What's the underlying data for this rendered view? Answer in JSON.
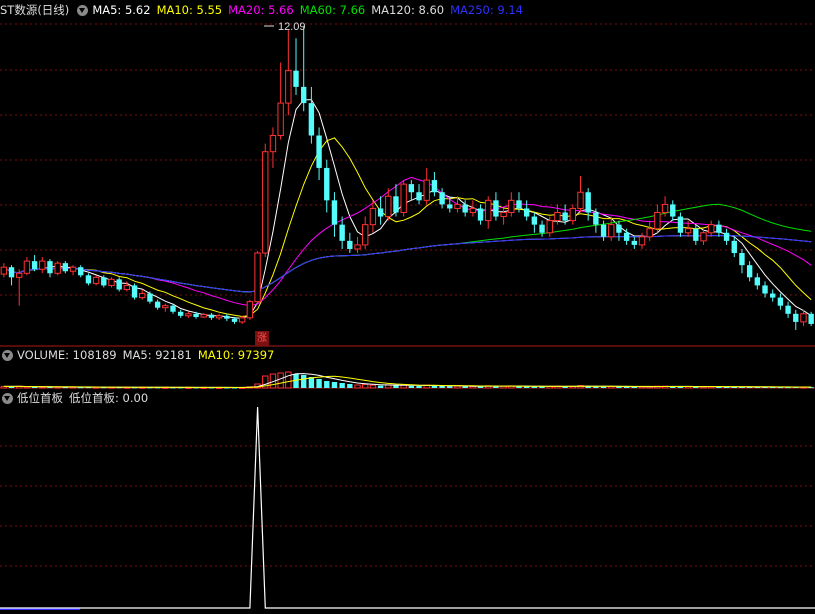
{
  "main": {
    "title": "ST数源(日线)",
    "ma": [
      {
        "label": "MA5: 5.62",
        "color": "#ffffff"
      },
      {
        "label": "MA10: 5.55",
        "color": "#ffff00"
      },
      {
        "label": "MA20: 5.66",
        "color": "#ff00ff"
      },
      {
        "label": "MA60: 7.66",
        "color": "#00e000"
      },
      {
        "label": "MA120: 8.60",
        "color": "#dddddd"
      },
      {
        "label": "MA250: 9.14",
        "color": "#3030ff"
      }
    ],
    "high_label": "12.09",
    "up_mark": "涨"
  },
  "volume": {
    "labels": [
      {
        "text": "VOLUME: 108189",
        "color": "#dddddd"
      },
      {
        "text": "MA5: 92181",
        "color": "#dddddd"
      },
      {
        "text": "MA10: 97397",
        "color": "#ffff00"
      }
    ]
  },
  "indicator": {
    "labels": [
      {
        "text": "低位首板",
        "color": "#dddddd"
      },
      {
        "text": "低位首板: 0.00",
        "color": "#dddddd"
      }
    ]
  },
  "colors": {
    "up": "#ff3232",
    "down": "#54fcfc",
    "grid": "#7a1010",
    "separator": "#b01818"
  },
  "chart_data": {
    "type": "candlestick",
    "price_range": [
      4.6,
      12.3
    ],
    "high_marker": 12.09,
    "candles": [
      [
        5.98,
        6.15,
        6.25,
        5.9
      ],
      [
        6.15,
        5.9,
        6.2,
        5.7
      ],
      [
        5.9,
        6.0,
        6.1,
        5.2
      ],
      [
        6.0,
        6.3,
        6.4,
        5.95
      ],
      [
        6.3,
        6.1,
        6.45,
        6.05
      ],
      [
        6.1,
        6.3,
        6.4,
        6.0
      ],
      [
        6.3,
        6.0,
        6.35,
        5.9
      ],
      [
        6.0,
        6.25,
        6.3,
        5.95
      ],
      [
        6.25,
        6.05,
        6.3,
        6.0
      ],
      [
        6.05,
        6.15,
        6.2,
        5.95
      ],
      [
        6.15,
        5.95,
        6.2,
        5.9
      ],
      [
        5.95,
        5.75,
        6.0,
        5.7
      ],
      [
        5.75,
        5.9,
        5.95,
        5.7
      ],
      [
        5.9,
        5.7,
        5.95,
        5.65
      ],
      [
        5.7,
        5.85,
        5.9,
        5.65
      ],
      [
        5.85,
        5.6,
        5.9,
        5.55
      ],
      [
        5.6,
        5.7,
        5.8,
        5.55
      ],
      [
        5.7,
        5.4,
        5.75,
        5.35
      ],
      [
        5.4,
        5.5,
        5.6,
        5.35
      ],
      [
        5.5,
        5.3,
        5.55,
        5.25
      ],
      [
        5.3,
        5.15,
        5.35,
        5.1
      ],
      [
        5.15,
        5.2,
        5.25,
        5.05
      ],
      [
        5.2,
        5.05,
        5.25,
        5.0
      ],
      [
        5.05,
        4.95,
        5.1,
        4.9
      ],
      [
        4.95,
        5.0,
        5.05,
        4.9
      ],
      [
        5.0,
        4.92,
        5.05,
        4.88
      ],
      [
        4.92,
        4.98,
        5.02,
        4.9
      ],
      [
        4.98,
        4.9,
        5.02,
        4.85
      ],
      [
        4.9,
        4.95,
        5.0,
        4.85
      ],
      [
        4.95,
        4.88,
        5.0,
        4.82
      ],
      [
        4.88,
        4.8,
        4.92,
        4.75
      ],
      [
        4.8,
        4.9,
        4.95,
        4.75
      ],
      [
        4.9,
        5.3,
        5.35,
        4.85
      ],
      [
        5.3,
        6.5,
        6.55,
        5.25
      ],
      [
        6.5,
        9.0,
        9.2,
        6.4
      ],
      [
        9.0,
        9.4,
        9.6,
        8.6
      ],
      [
        9.4,
        10.2,
        11.2,
        9.3
      ],
      [
        10.2,
        11.0,
        12.0,
        9.9
      ],
      [
        11.0,
        10.6,
        11.8,
        10.4
      ],
      [
        10.6,
        10.2,
        12.09,
        10.0
      ],
      [
        10.2,
        9.4,
        10.6,
        9.2
      ],
      [
        9.4,
        8.6,
        9.6,
        8.3
      ],
      [
        8.6,
        7.8,
        8.8,
        7.5
      ],
      [
        7.8,
        7.2,
        8.0,
        6.9
      ],
      [
        7.2,
        6.8,
        7.4,
        6.6
      ],
      [
        6.8,
        6.6,
        7.0,
        6.5
      ],
      [
        6.6,
        6.7,
        6.9,
        6.5
      ],
      [
        6.7,
        7.2,
        7.4,
        6.6
      ],
      [
        7.2,
        7.6,
        7.8,
        7.0
      ],
      [
        7.6,
        7.4,
        7.9,
        7.2
      ],
      [
        7.4,
        7.9,
        8.1,
        7.3
      ],
      [
        7.9,
        7.5,
        8.2,
        7.4
      ],
      [
        7.5,
        8.2,
        8.3,
        7.4
      ],
      [
        8.2,
        8.0,
        8.3,
        7.8
      ],
      [
        8.0,
        7.8,
        8.2,
        7.7
      ],
      [
        7.8,
        8.3,
        8.6,
        7.7
      ],
      [
        8.3,
        8.0,
        8.5,
        7.9
      ],
      [
        8.0,
        7.7,
        8.1,
        7.6
      ],
      [
        7.7,
        7.6,
        7.9,
        7.5
      ],
      [
        7.6,
        7.7,
        7.9,
        7.5
      ],
      [
        7.7,
        7.5,
        7.8,
        7.4
      ],
      [
        7.5,
        7.6,
        7.8,
        7.4
      ],
      [
        7.6,
        7.3,
        7.7,
        7.2
      ],
      [
        7.3,
        7.8,
        7.9,
        7.1
      ],
      [
        7.8,
        7.4,
        8.0,
        7.3
      ],
      [
        7.4,
        7.5,
        7.6,
        7.2
      ],
      [
        7.5,
        7.8,
        8.0,
        7.4
      ],
      [
        7.8,
        7.6,
        8.0,
        7.5
      ],
      [
        7.6,
        7.4,
        7.8,
        7.3
      ],
      [
        7.4,
        7.2,
        7.5,
        7.0
      ],
      [
        7.2,
        7.0,
        7.3,
        6.9
      ],
      [
        7.0,
        7.3,
        7.4,
        6.9
      ],
      [
        7.3,
        7.5,
        7.7,
        7.2
      ],
      [
        7.5,
        7.3,
        7.7,
        7.2
      ],
      [
        7.3,
        7.6,
        7.7,
        7.2
      ],
      [
        7.6,
        8.0,
        8.4,
        7.5
      ],
      [
        8.0,
        7.5,
        8.1,
        7.3
      ],
      [
        7.5,
        7.2,
        7.6,
        7.0
      ],
      [
        7.2,
        6.9,
        7.3,
        6.8
      ],
      [
        6.9,
        7.2,
        7.4,
        6.8
      ],
      [
        7.2,
        7.0,
        7.3,
        6.8
      ],
      [
        7.0,
        6.8,
        7.1,
        6.7
      ],
      [
        6.8,
        6.7,
        6.9,
        6.6
      ],
      [
        6.7,
        6.9,
        7.0,
        6.6
      ],
      [
        6.9,
        7.1,
        7.3,
        6.8
      ],
      [
        7.1,
        7.5,
        7.7,
        7.0
      ],
      [
        7.5,
        7.7,
        7.9,
        7.4
      ],
      [
        7.7,
        7.4,
        7.8,
        7.3
      ],
      [
        7.4,
        7.0,
        7.5,
        6.9
      ],
      [
        7.0,
        7.1,
        7.3,
        6.9
      ],
      [
        7.1,
        6.8,
        7.2,
        6.7
      ],
      [
        6.8,
        7.0,
        7.1,
        6.7
      ],
      [
        7.0,
        7.2,
        7.3,
        6.9
      ],
      [
        7.2,
        7.0,
        7.3,
        6.9
      ],
      [
        7.0,
        6.8,
        7.1,
        6.7
      ],
      [
        6.8,
        6.5,
        6.9,
        6.4
      ],
      [
        6.5,
        6.2,
        6.6,
        6.0
      ],
      [
        6.2,
        5.9,
        6.3,
        5.8
      ],
      [
        5.9,
        5.7,
        6.0,
        5.6
      ],
      [
        5.7,
        5.5,
        5.8,
        5.4
      ],
      [
        5.5,
        5.4,
        5.6,
        5.3
      ],
      [
        5.4,
        5.2,
        5.5,
        5.1
      ],
      [
        5.2,
        5.0,
        5.3,
        4.9
      ],
      [
        5.0,
        4.8,
        5.1,
        4.6
      ],
      [
        4.8,
        5.0,
        5.1,
        4.7
      ],
      [
        5.0,
        4.75,
        5.05,
        4.7
      ]
    ],
    "volume_range": [
      0,
      120000
    ],
    "volumes": [
      8000,
      7500,
      9000,
      6000,
      5000,
      5500,
      6000,
      5000,
      4500,
      5000,
      4000,
      4500,
      4200,
      3800,
      4000,
      3900,
      3600,
      3500,
      3400,
      3300,
      3200,
      3100,
      3000,
      3000,
      2900,
      2800,
      2900,
      2700,
      2800,
      2600,
      2500,
      2700,
      6000,
      20000,
      60000,
      70000,
      75000,
      80000,
      70000,
      65000,
      55000,
      45000,
      35000,
      30000,
      25000,
      20000,
      15000,
      18000,
      14000,
      12000,
      16000,
      13000,
      15000,
      11000,
      10000,
      14000,
      12000,
      10000,
      9000,
      9500,
      9000,
      8500,
      8000,
      11000,
      10000,
      9000,
      10500,
      8800,
      8000,
      7500,
      7000,
      8200,
      9000,
      7600,
      8400,
      12000,
      9500,
      8000,
      7000,
      7600,
      7000,
      6500,
      6200,
      6600,
      7200,
      8800,
      9000,
      7500,
      6800,
      7000,
      6500,
      6800,
      7000,
      6600,
      6200,
      5800,
      5500,
      5200,
      5000,
      5200,
      4800,
      4600,
      4400,
      5000,
      4700,
      4500
    ],
    "indicator_range": [
      0,
      1
    ],
    "indicator_spike_index": 33,
    "indicator_value": 0.0
  }
}
